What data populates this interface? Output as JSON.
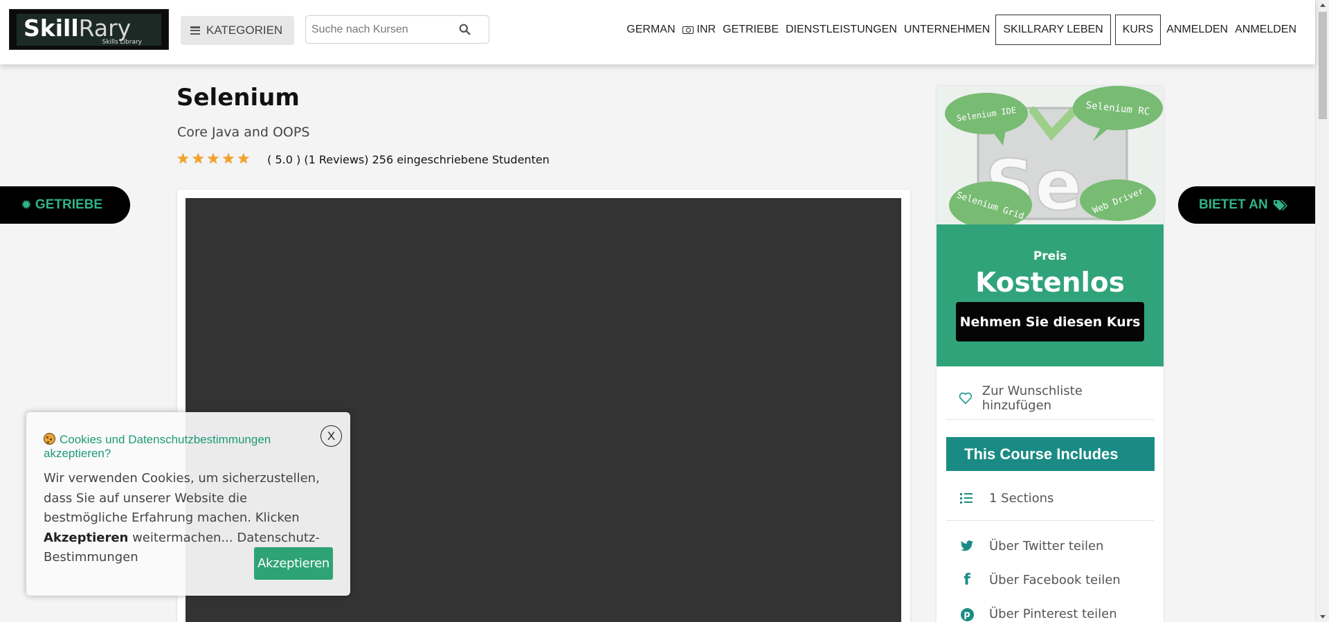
{
  "header": {
    "logo_text_main": "Skill",
    "logo_text_alt": "Rary",
    "logo_tagline": "Skills Library",
    "categories_label": "KATEGORIEN",
    "search_placeholder": "Suche nach Kursen",
    "nav": {
      "language": "GERMAN",
      "currency": "INR",
      "getriebe": "GETRIEBE",
      "services": "DIENSTLEISTUNGEN",
      "company": "UNTERNEHMEN",
      "live": "SKILLRARY LEBEN",
      "course": "KURS",
      "login": "ANMELDEN",
      "signup": "ANMELDEN"
    }
  },
  "side_tabs": {
    "left": "GETRIEBE",
    "right": "BIETET AN"
  },
  "course": {
    "title": "Selenium",
    "subtitle": "Core Java and OOPS",
    "rating_value": 5,
    "rating_text": "( 5.0 ) (1 Reviews) 256 eingeschriebene Studenten"
  },
  "thumbnail": {
    "big_letters": "Se",
    "bubbles": [
      "Selenium IDE",
      "Selenium RC",
      "Selenium Grid",
      "Web Driver"
    ]
  },
  "sidebar": {
    "price_label": "Preis",
    "price_value": "Kostenlos",
    "take_course": "Nehmen Sie diesen Kurs",
    "wishlist": "Zur Wunschliste hinzufügen",
    "includes_title": "This Course Includes",
    "sections": "1 Sections",
    "share_twitter": "Über Twitter teilen",
    "share_facebook": "Über Facebook teilen",
    "share_pinterest": "Über Pinterest teilen"
  },
  "cookie": {
    "title": "Cookies und Datenschutzbestimmungen akzeptieren?",
    "close": "X",
    "body_1": "Wir verwenden Cookies, um sicherzustellen, dass Sie auf unserer Website die bestmögliche Erfahrung machen. Klicken ",
    "body_bold": "Akzeptieren",
    "body_2": " weitermachen... Datenschutz-Bestimmungen",
    "accept": "Akzeptieren"
  },
  "colors": {
    "brand_green": "#31a37a",
    "teal": "#1a8b84",
    "video_bg": "#333333"
  }
}
